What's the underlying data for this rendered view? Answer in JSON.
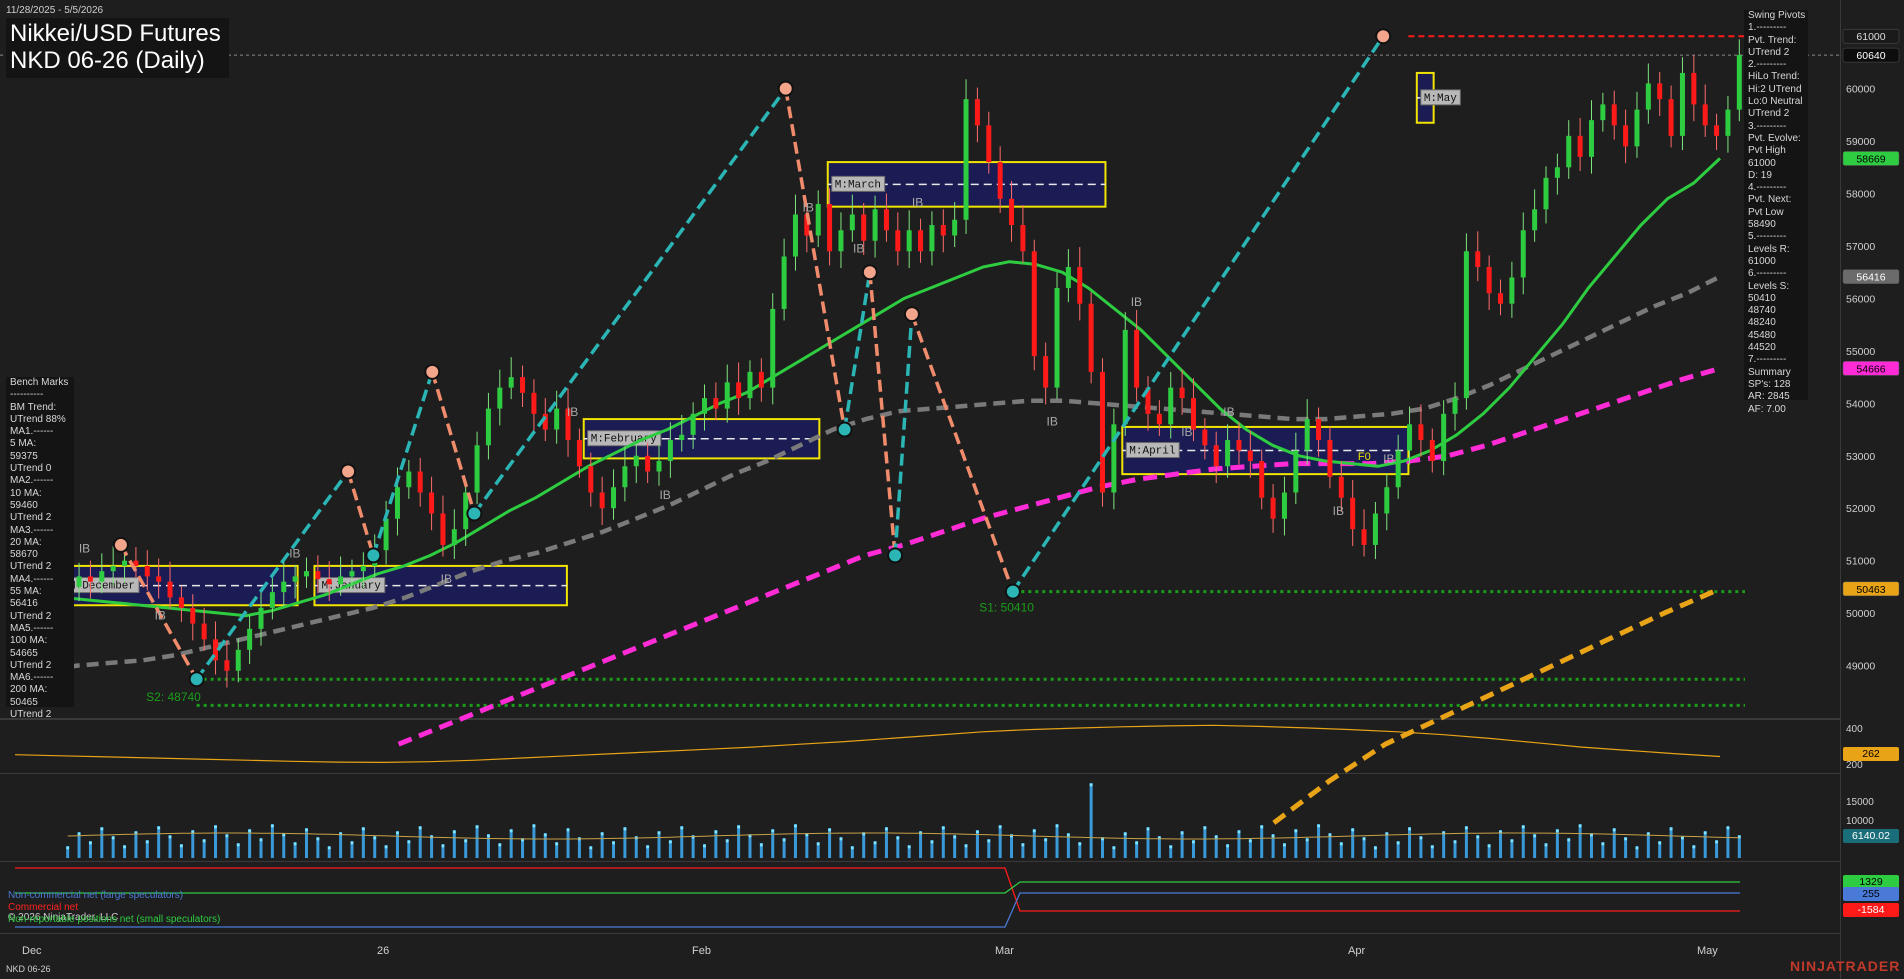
{
  "header": {
    "date_range": "11/28/2025 - 5/5/2026",
    "title_line1": "Nikkei/USD Futures",
    "title_line2": "NKD 06-26 (Daily)"
  },
  "swing_panel": {
    "text": "Swing Pivots\n1.---------\nPvt. Trend:\nUTrend 2\n2.---------\nHiLo Trend:\nHi:2 UTrend\nLo:0 Neutral\nUTrend 2\n3.---------\nPvt. Evolve:\nPvt High\n61000\nD: 19\n4.---------\nPvt. Next:\nPvt Low\n58490\n5.---------\nLevels R:\n61000\n6.---------\nLevels S:\n50410\n48740\n48240\n45480\n44520\n7.---------\nSummary\nSP's: 128\nAR: 2845\nAF: 7.00"
  },
  "bench_panel": {
    "text": "Bench Marks\n----------\nBM Trend:\nUTrend 88%\nMA1.------\n5 MA:\n59375\nUTrend 0\nMA2.------\n10 MA:\n59460\nUTrend 2\nMA3.------\n20 MA:\n58670\nUTrend 2\nMA4.------\n55 MA:\n56416\nUTrend 2\nMA5.------\n100 MA:\n54665\nUTrend 2\nMA6.------\n200 MA:\n50465\nUTrend 2"
  },
  "price_tags": [
    {
      "label": "61000",
      "value": 61000,
      "bg": "#1a1a1a",
      "fg": "#dddddd"
    },
    {
      "label": "60640",
      "value": 60640,
      "bg": "#0d0d0d",
      "fg": "#ffffff"
    },
    {
      "label": "58669",
      "value": 58669,
      "bg": "#2ecc40",
      "fg": "#000000"
    },
    {
      "label": "56416",
      "value": 56416,
      "bg": "#6b6b6b",
      "fg": "#ffffff"
    },
    {
      "label": "54666",
      "value": 54666,
      "bg": "#ff2bd6",
      "fg": "#000000"
    },
    {
      "label": "50463",
      "value": 50463,
      "bg": "#e8a317",
      "fg": "#000000"
    }
  ],
  "osc_tags": [
    {
      "label": "262",
      "bg": "#e8a317",
      "fg": "#000000",
      "panel": "atr"
    },
    {
      "label": "6140.02",
      "bg": "#1a6e7a",
      "fg": "#ffffff",
      "panel": "vol"
    },
    {
      "label": "1329",
      "bg": "#2ecc40",
      "fg": "#000000",
      "panel": "cot1"
    },
    {
      "label": "255",
      "bg": "#4a7ad8",
      "fg": "#000000",
      "panel": "cot2"
    },
    {
      "label": "-1584",
      "bg": "#ff1a1a",
      "fg": "#ffffff",
      "panel": "cot3"
    }
  ],
  "osc_ticks": {
    "atr": [
      "400",
      "200"
    ],
    "vol": [
      "15000",
      "10000"
    ]
  },
  "x_labels": [
    "Dec",
    "26",
    "Feb",
    "Mar",
    "Apr",
    "May"
  ],
  "legend": {
    "noncommercial": "Non-commercial net (large speculators)",
    "commercial": "Commercial net",
    "copyright": "© 2026 NinjaTrader, LLC",
    "nonreportable": "Non-reportable positions net (small speculators)"
  },
  "footer": {
    "instrument": "NKD 06-26",
    "brand": "NINJATRADER"
  },
  "zone_labels": [
    "M:December",
    "M:January",
    "M:February",
    "M:March",
    "M:April",
    "M:May"
  ],
  "support_labels": [
    "S1: 50410",
    "S2: 48740"
  ],
  "misc_labels": {
    "ib": "IB",
    "f0": "F0"
  },
  "colors": {
    "background": "#1e1e1e",
    "up_candle": "#2ecc40",
    "down_candle": "#ff1a1a",
    "ma_20": "#2ecc40",
    "ma_55": "#7a7a7a",
    "ma_100": "#ff2bd6",
    "ma_200": "#e8a317",
    "swing_up": "#2bb5b5",
    "swing_down": "#f08c6c",
    "zone_border": "#f1e400",
    "zone_fill": "#1c1c55",
    "resistance": "#ff1a1a",
    "support": "#1a9e1a"
  },
  "chart_data": {
    "type": "candlestick",
    "y_axis": {
      "min": 48000,
      "max": 61500,
      "ticks": [
        49000,
        50000,
        51000,
        52000,
        53000,
        54000,
        55000,
        56000,
        57000,
        58000,
        59000,
        60000,
        61000
      ]
    },
    "x_axis_labels": [
      "Dec",
      "26",
      "Feb",
      "Mar",
      "Apr",
      "May"
    ],
    "last_price": 60640,
    "resistance_level": 61000,
    "support_levels": [
      50410,
      48740,
      48240
    ],
    "moving_averages": [
      {
        "label": "5 MA",
        "value": 59375
      },
      {
        "label": "10 MA",
        "value": 59460
      },
      {
        "label": "20 MA",
        "value": 58670
      },
      {
        "label": "55 MA",
        "value": 56416
      },
      {
        "label": "100 MA",
        "value": 54665
      },
      {
        "label": "200 MA",
        "value": 50465
      }
    ],
    "swing_pivots": [
      {
        "type": "high",
        "value": 51300
      },
      {
        "type": "low",
        "value": 48740
      },
      {
        "type": "high",
        "value": 52700
      },
      {
        "type": "low",
        "value": 51100
      },
      {
        "type": "high",
        "value": 54600
      },
      {
        "type": "low",
        "value": 51900
      },
      {
        "type": "high",
        "value": 60000
      },
      {
        "type": "low",
        "value": 53500
      },
      {
        "type": "high",
        "value": 56500
      },
      {
        "type": "low",
        "value": 51100
      },
      {
        "type": "high",
        "value": 55700
      },
      {
        "type": "low",
        "value": 50410
      },
      {
        "type": "high",
        "value": 61000
      }
    ],
    "monthly_zones": [
      {
        "label": "M:December",
        "high": 50900,
        "low": 50150,
        "mid": 50525
      },
      {
        "label": "M:January",
        "high": 50900,
        "low": 50150,
        "mid": 50525
      },
      {
        "label": "M:February",
        "high": 53700,
        "low": 52950,
        "mid": 53325
      },
      {
        "label": "M:March",
        "high": 58600,
        "low": 57750,
        "mid": 58175
      },
      {
        "label": "M:April",
        "high": 53550,
        "low": 52650,
        "mid": 53100
      },
      {
        "label": "M:May",
        "high": 60300,
        "low": 59350,
        "mid": 59825
      }
    ],
    "closes": [
      50500,
      50700,
      50600,
      50800,
      50900,
      51000,
      50900,
      50700,
      50600,
      50300,
      50100,
      49800,
      49500,
      49100,
      48900,
      49300,
      49700,
      50100,
      50400,
      50600,
      50700,
      50800,
      50650,
      50550,
      50700,
      50800,
      50900,
      51200,
      51800,
      52400,
      52700,
      52300,
      51900,
      51300,
      51600,
      52300,
      53200,
      53900,
      54300,
      54500,
      54200,
      53800,
      53500,
      53900,
      53300,
      52800,
      52300,
      52000,
      52400,
      52800,
      53000,
      52700,
      52900,
      53300,
      53400,
      53800,
      54100,
      53900,
      54400,
      54100,
      54600,
      54300,
      55800,
      56800,
      57600,
      57200,
      57800,
      56900,
      57300,
      57600,
      57100,
      57700,
      57300,
      56900,
      57300,
      56900,
      57400,
      57200,
      57500,
      59800,
      59300,
      58600,
      57900,
      57400,
      56900,
      54900,
      54300,
      56200,
      56600,
      55900,
      54600,
      52300,
      53600,
      55400,
      54300,
      53800,
      53600,
      54300,
      54100,
      53500,
      53200,
      52800,
      53300,
      53100,
      52900,
      52200,
      51800,
      52300,
      53100,
      53700,
      53300,
      52600,
      52200,
      51600,
      51300,
      51900,
      52400,
      53100,
      53600,
      53300,
      52900,
      53800,
      54100,
      56900,
      56600,
      56100,
      55900,
      56400,
      57300,
      57700,
      58300,
      58500,
      59100,
      58700,
      59400,
      59700,
      59300,
      58900,
      59600,
      60100,
      59800,
      59100,
      60300,
      59700,
      59300,
      59100,
      59600,
      60640
    ],
    "ma20_values": [
      50300,
      50250,
      50200,
      50150,
      50100,
      50050,
      50000,
      49950,
      50050,
      50200,
      50350,
      50550,
      50750,
      50900,
      51100,
      51350,
      51650,
      51950,
      52200,
      52500,
      52800,
      53050,
      53300,
      53500,
      53750,
      54000,
      54200,
      54500,
      54800,
      55100,
      55400,
      55700,
      56000,
      56200,
      56400,
      56600,
      56700,
      56650,
      56500,
      56200,
      55800,
      55400,
      54900,
      54400,
      53900,
      53500,
      53200,
      53000,
      52900,
      52850,
      52800,
      52900,
      53100,
      53400,
      53800,
      54300,
      54900,
      55500,
      56200,
      56800,
      57400,
      57900,
      58200,
      58670
    ],
    "ma55_values": [
      48800,
      48900,
      49000,
      49050,
      49100,
      49200,
      49350,
      49500,
      49650,
      49800,
      49950,
      50100,
      50300,
      50550,
      50800,
      51000,
      51150,
      51350,
      51550,
      51800,
      52050,
      52350,
      52650,
      52900,
      53200,
      53500,
      53700,
      53850,
      53900,
      53950,
      54000,
      54050,
      54050,
      54000,
      53950,
      53900,
      53850,
      53800,
      53750,
      53700,
      53700,
      53750,
      53800,
      53900,
      54100,
      54350,
      54650,
      54950,
      55250,
      55550,
      55850,
      56100,
      56416
    ],
    "ma100_values": [
      47500,
      47800,
      48100,
      48400,
      48700,
      49000,
      49300,
      49600,
      49900,
      50200,
      50500,
      50800,
      51100,
      51300,
      51550,
      51800,
      52000,
      52200,
      52400,
      52550,
      52650,
      52750,
      52800,
      52850,
      52850,
      52850,
      52900,
      53000,
      53200,
      53450,
      53700,
      53950,
      54200,
      54450,
      54666
    ],
    "ma200_values": [
      46000,
      46800,
      47500,
      48000,
      48500,
      49000,
      49500,
      50000,
      50463
    ],
    "atr_values": [
      270,
      265,
      260,
      255,
      250,
      245,
      240,
      236,
      235,
      238,
      245,
      255,
      265,
      275,
      285,
      295,
      305,
      318,
      330,
      345,
      360,
      375,
      385,
      392,
      398,
      402,
      405,
      400,
      393,
      385,
      375,
      362,
      345,
      325,
      305,
      290,
      275,
      262
    ],
    "volume_note": "daily volume histogram with ~6140 recent",
    "cot": {
      "noncommercial": 255,
      "commercial": -1584,
      "nonreportable": 1329
    }
  }
}
